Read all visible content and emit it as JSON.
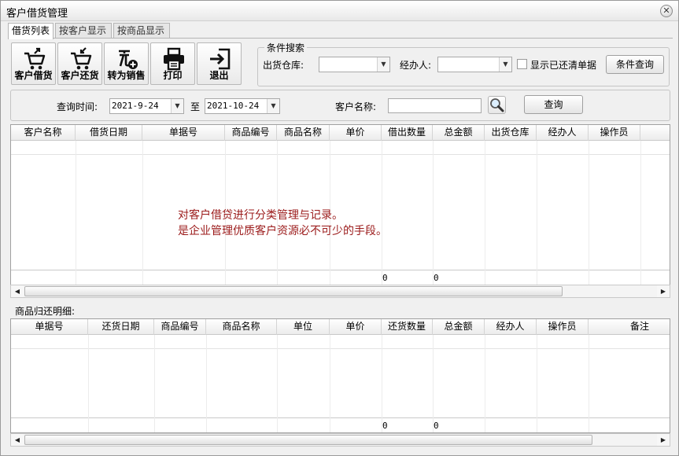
{
  "window": {
    "title": "客户借货管理"
  },
  "tabs": [
    {
      "label": "借货列表",
      "active": true
    },
    {
      "label": "按客户显示",
      "active": false
    },
    {
      "label": "按商品显示",
      "active": false
    }
  ],
  "toolbar": {
    "borrow": "客户借货",
    "return": "客户还货",
    "to_sale": "转为销售",
    "print": "打印",
    "exit": "退出"
  },
  "search_group": {
    "legend": "条件搜索",
    "warehouse_label": "出货仓库:",
    "warehouse_value": "",
    "handler_label": "经办人:",
    "handler_value": "",
    "show_returned_label": "显示已还清单据",
    "query_button": "条件查询"
  },
  "query_panel": {
    "time_label": "查询时间:",
    "date_from": "2021-9-24",
    "to_label": "至",
    "date_to": "2021-10-24",
    "customer_label": "客户名称:",
    "customer_value": "",
    "query_button": "查询"
  },
  "borrow_grid": {
    "columns": [
      "客户名称",
      "借货日期",
      "单据号",
      "商品编号",
      "商品名称",
      "单价",
      "借出数量",
      "总金额",
      "出货仓库",
      "经办人",
      "操作员"
    ],
    "footer_qty": "0",
    "footer_amount": "0"
  },
  "promo": {
    "line1": "对客户借贷进行分类管理与记录。",
    "line2": "是企业管理优质客户资源必不可少的手段。"
  },
  "return_section": {
    "label": "商品归还明细:",
    "columns": [
      "单据号",
      "还货日期",
      "商品编号",
      "商品名称",
      "单位",
      "单价",
      "还货数量",
      "总金额",
      "经办人",
      "操作员",
      "备注"
    ],
    "footer_qty": "0",
    "footer_amount": "0"
  },
  "icons": {
    "borrow": "cart-arrow-out-icon",
    "return": "cart-arrow-in-icon",
    "to_sale": "yen-plus-icon",
    "print": "printer-icon",
    "exit": "exit-arrow-icon",
    "search": "magnifier-icon"
  }
}
